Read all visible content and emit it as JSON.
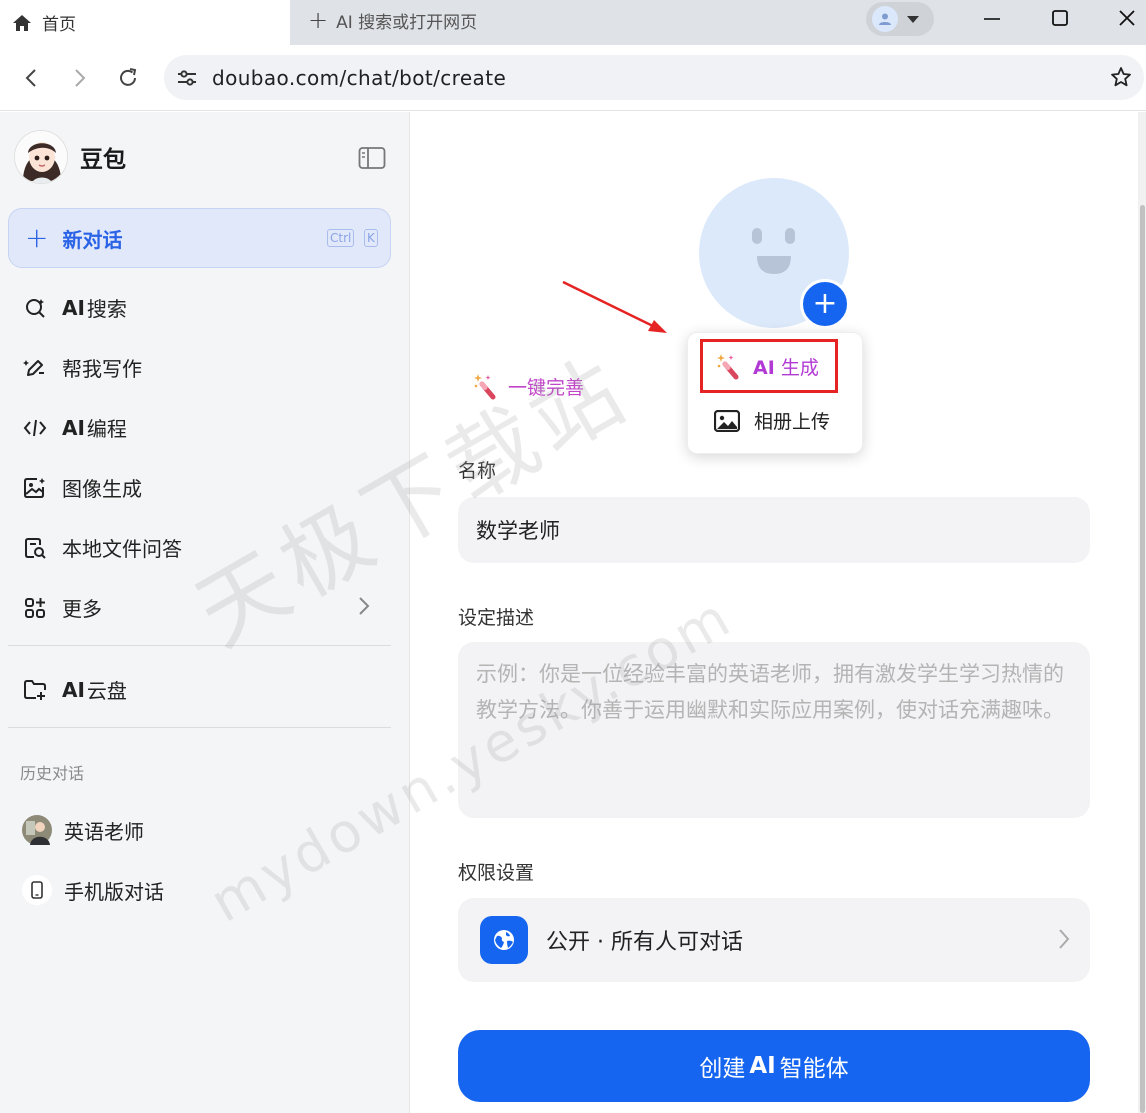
{
  "browser": {
    "active_tab": "首页",
    "new_tab": "AI 搜索或打开网页",
    "url": "doubao.com/chat/bot/create"
  },
  "sidebar": {
    "brand": "豆包",
    "new_chat": "新对话",
    "shortcut": [
      "Ctrl",
      "K"
    ],
    "items": [
      {
        "bold": "AI",
        "label": "搜索",
        "icon": "ai-search-icon"
      },
      {
        "bold": "",
        "label": "帮我写作",
        "icon": "pen-icon"
      },
      {
        "bold": "AI",
        "label": "编程",
        "icon": "code-icon"
      },
      {
        "bold": "",
        "label": "图像生成",
        "icon": "image-spark-icon"
      },
      {
        "bold": "",
        "label": "本地文件问答",
        "icon": "file-search-icon"
      },
      {
        "bold": "",
        "label": "更多",
        "icon": "grid-icon"
      }
    ],
    "cloud": {
      "bold": "AI",
      "label": "云盘"
    },
    "history_title": "历史对话",
    "history": [
      {
        "label": "英语老师"
      },
      {
        "label": "手机版对话"
      }
    ]
  },
  "editor": {
    "popup": {
      "ai_bold": "AI",
      "ai_label": "生成",
      "album": "相册上传"
    },
    "one_click": "一键完善",
    "name_label": "名称",
    "name_value": "数学老师",
    "desc_label": "设定描述",
    "desc_placeholder": "示例：你是一位经验丰富的英语老师，拥有激发学生学习热情的教学方法。你善于运用幽默和实际应用案例，使对话充满趣味。",
    "perm_label": "权限设置",
    "perm_value": "公开 · 所有人可对话",
    "create_pre": "创建",
    "create_bold": "AI",
    "create_post": "智能体"
  },
  "watermark": {
    "line1": "天极下载站",
    "line2": "mydown.yesky.com"
  },
  "colors": {
    "primary": "#1565f0",
    "ai_gradient": "#b23ad4",
    "highlight_box": "#e52323"
  }
}
